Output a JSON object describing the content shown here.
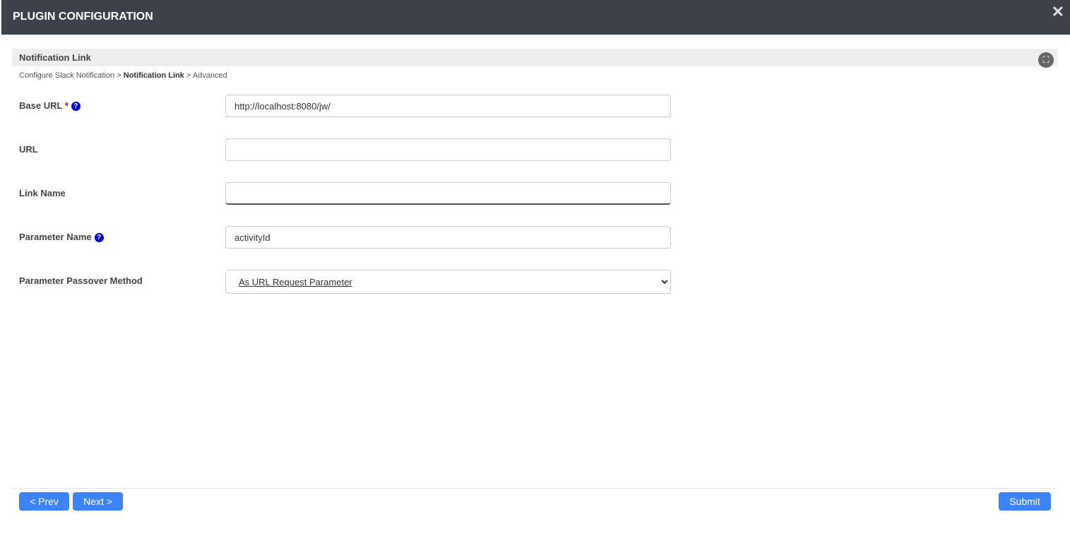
{
  "header": {
    "title": "PLUGIN CONFIGURATION",
    "close": "✕"
  },
  "section": {
    "title": "Notification Link",
    "fullscreen_icon": "⛶"
  },
  "breadcrumb": {
    "items": [
      "Configure Slack Notification",
      "Notification Link",
      "Advanced"
    ],
    "sep": ">"
  },
  "fields": [
    {
      "label": "Base URL",
      "required": "*",
      "help": "?",
      "value": ""
    },
    {
      "label": "URL",
      "value": ""
    },
    {
      "label": "Link Name",
      "value": ""
    },
    {
      "label": "Parameter Name",
      "help": "?",
      "value": "activityId"
    },
    {
      "label": "Parameter Passover Method",
      "value": "As URL Request Parameter"
    }
  ],
  "base_url_value": "http://localhost:8080/jw/",
  "buttons": {
    "prev": "< Prev",
    "next": "Next >",
    "submit": "Submit"
  }
}
